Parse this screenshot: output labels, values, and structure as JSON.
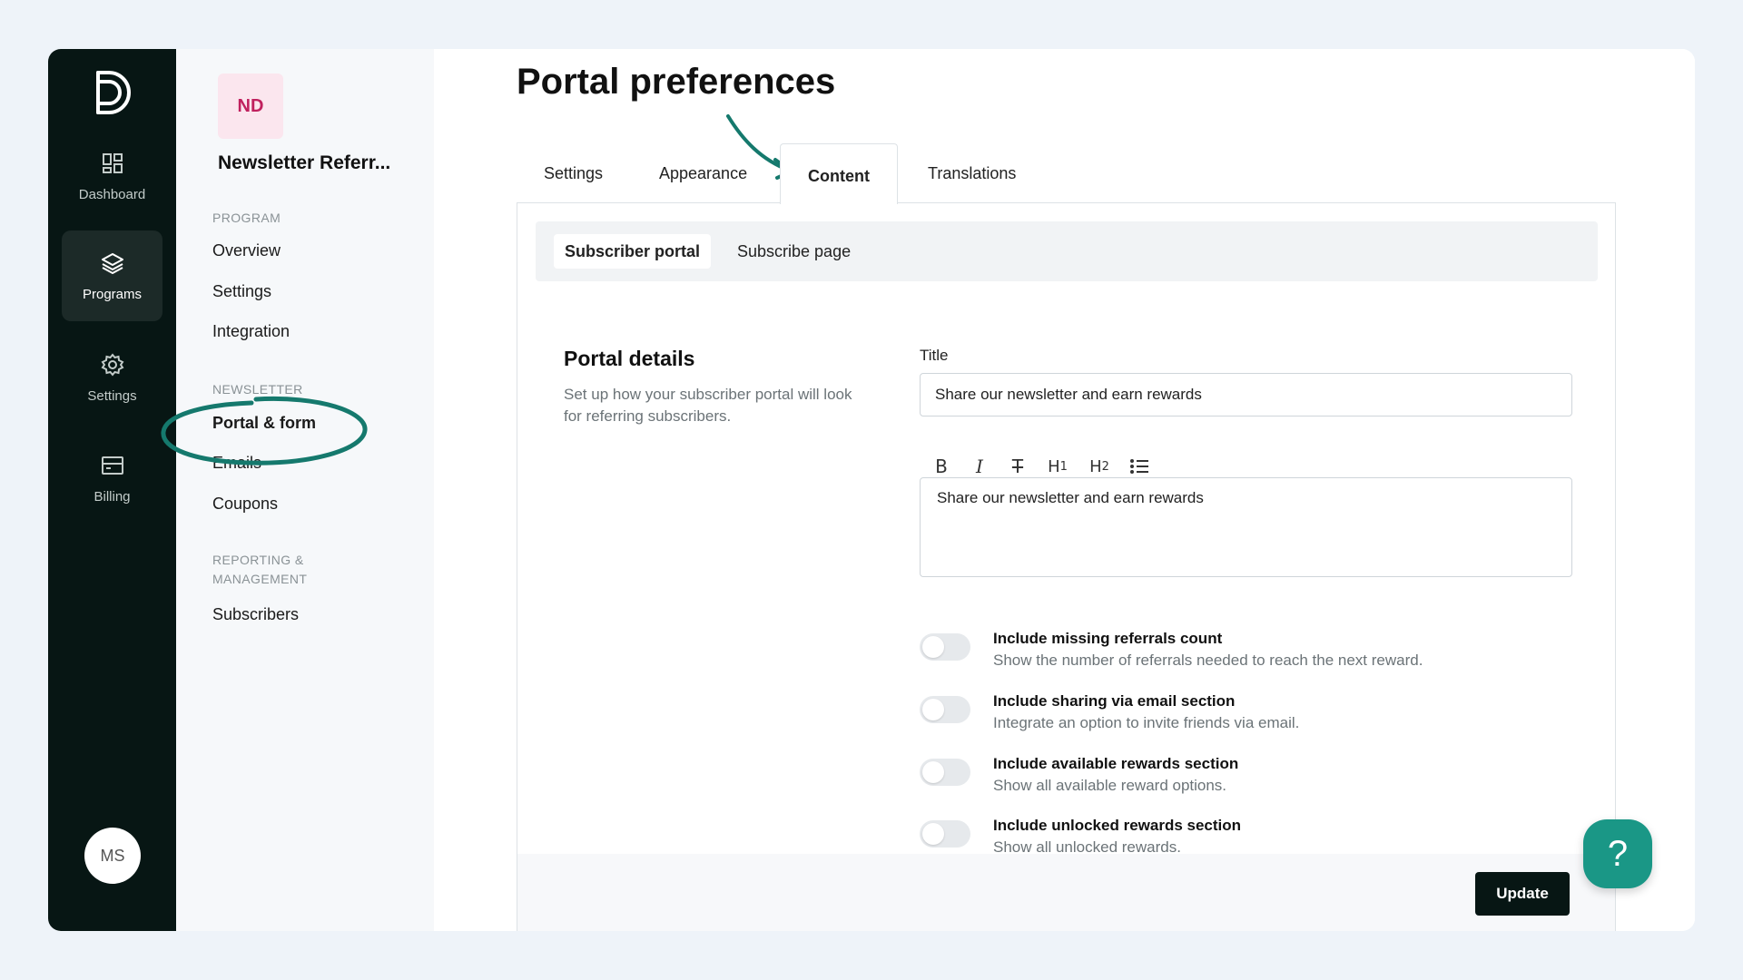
{
  "rail": {
    "items": [
      {
        "label": "Dashboard",
        "icon": "dashboard-icon"
      },
      {
        "label": "Programs",
        "icon": "layers-icon",
        "active": true
      },
      {
        "label": "Settings",
        "icon": "gear-icon"
      },
      {
        "label": "Billing",
        "icon": "billing-icon"
      }
    ],
    "user_initials": "MS"
  },
  "sidebar": {
    "program_initials": "ND",
    "program_name": "Newsletter Referr...",
    "sections": [
      {
        "heading": "PROGRAM",
        "items": [
          "Overview",
          "Settings",
          "Integration"
        ]
      },
      {
        "heading": "NEWSLETTER",
        "items": [
          "Portal & form",
          "Emails",
          "Coupons"
        ]
      },
      {
        "heading": "REPORTING & MANAGEMENT",
        "items": [
          "Subscribers"
        ]
      }
    ],
    "active_item": "Portal & form"
  },
  "main": {
    "title": "Portal preferences",
    "tabs": [
      "Settings",
      "Appearance",
      "Content",
      "Translations"
    ],
    "active_tab": "Content",
    "subtabs": [
      "Subscriber portal",
      "Subscribe page"
    ],
    "active_subtab": "Subscriber portal",
    "section": {
      "title": "Portal details",
      "description": "Set up how your subscriber portal will look for referring subscribers."
    },
    "title_field": {
      "label": "Title",
      "value": "Share our newsletter and earn rewards"
    },
    "editor": {
      "toolbar": [
        "B",
        "I",
        "T",
        "H1",
        "H2",
        "list"
      ],
      "content": "Share our newsletter and earn rewards"
    },
    "toggles": [
      {
        "title": "Include missing referrals count",
        "description": "Show the number of referrals needed to reach the next reward.",
        "on": false
      },
      {
        "title": "Include sharing via email section",
        "description": "Integrate an option to invite friends via email.",
        "on": false
      },
      {
        "title": "Include available rewards section",
        "description": "Show all available reward options.",
        "on": false
      },
      {
        "title": "Include unlocked rewards section",
        "description": "Show all unlocked rewards.",
        "on": false
      }
    ],
    "update_label": "Update"
  },
  "help": {
    "label": "?"
  },
  "colors": {
    "rail_bg": "#071614",
    "accent_teal": "#1a9786",
    "annotation": "#15796d",
    "nd_badge_bg": "#fbe6ee",
    "nd_badge_text": "#c0215e"
  }
}
